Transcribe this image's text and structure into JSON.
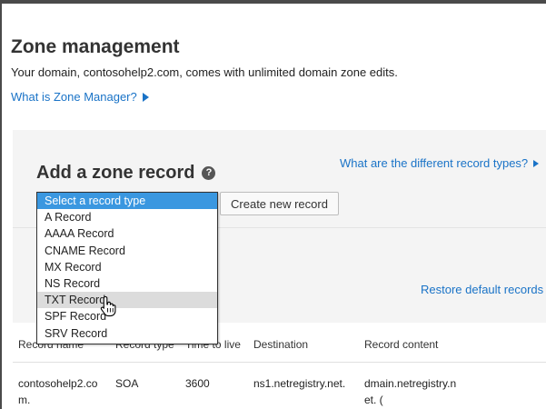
{
  "page": {
    "title": "Zone management",
    "intro": "Your domain, contosohelp2.com, comes with unlimited domain zone edits.",
    "zone_manager_link": "What is Zone Manager?"
  },
  "add_record": {
    "title": "Add a zone record",
    "help_icon_label": "?",
    "record_types_link": "What are the different record types?",
    "create_button": "Create new record",
    "restore_link": "Restore default records"
  },
  "record_type_select": {
    "options": [
      "Select a record type",
      "A Record",
      "AAAA Record",
      "CNAME Record",
      "MX Record",
      "NS Record",
      "TXT Record",
      "SPF Record",
      "SRV Record"
    ],
    "selected_index": 0,
    "hovered_index": 6
  },
  "table": {
    "headers": {
      "record_name": "Record name",
      "record_type": "Record type",
      "ttl": "Time to live",
      "destination": "Destination",
      "content": "Record content"
    },
    "rows": [
      {
        "name_line1": "contosohelp2.co",
        "name_line2": "m.",
        "type": "SOA",
        "ttl": "3600",
        "destination": "ns1.netregistry.net.",
        "content_line1": "dmain.netregistry.n",
        "content_line2": "et. ("
      }
    ]
  },
  "colors": {
    "link": "#1a73c7",
    "selected_option": "#3a97e0",
    "hover_option": "#dcdcdc",
    "panel_background": "#f4f4f4"
  }
}
